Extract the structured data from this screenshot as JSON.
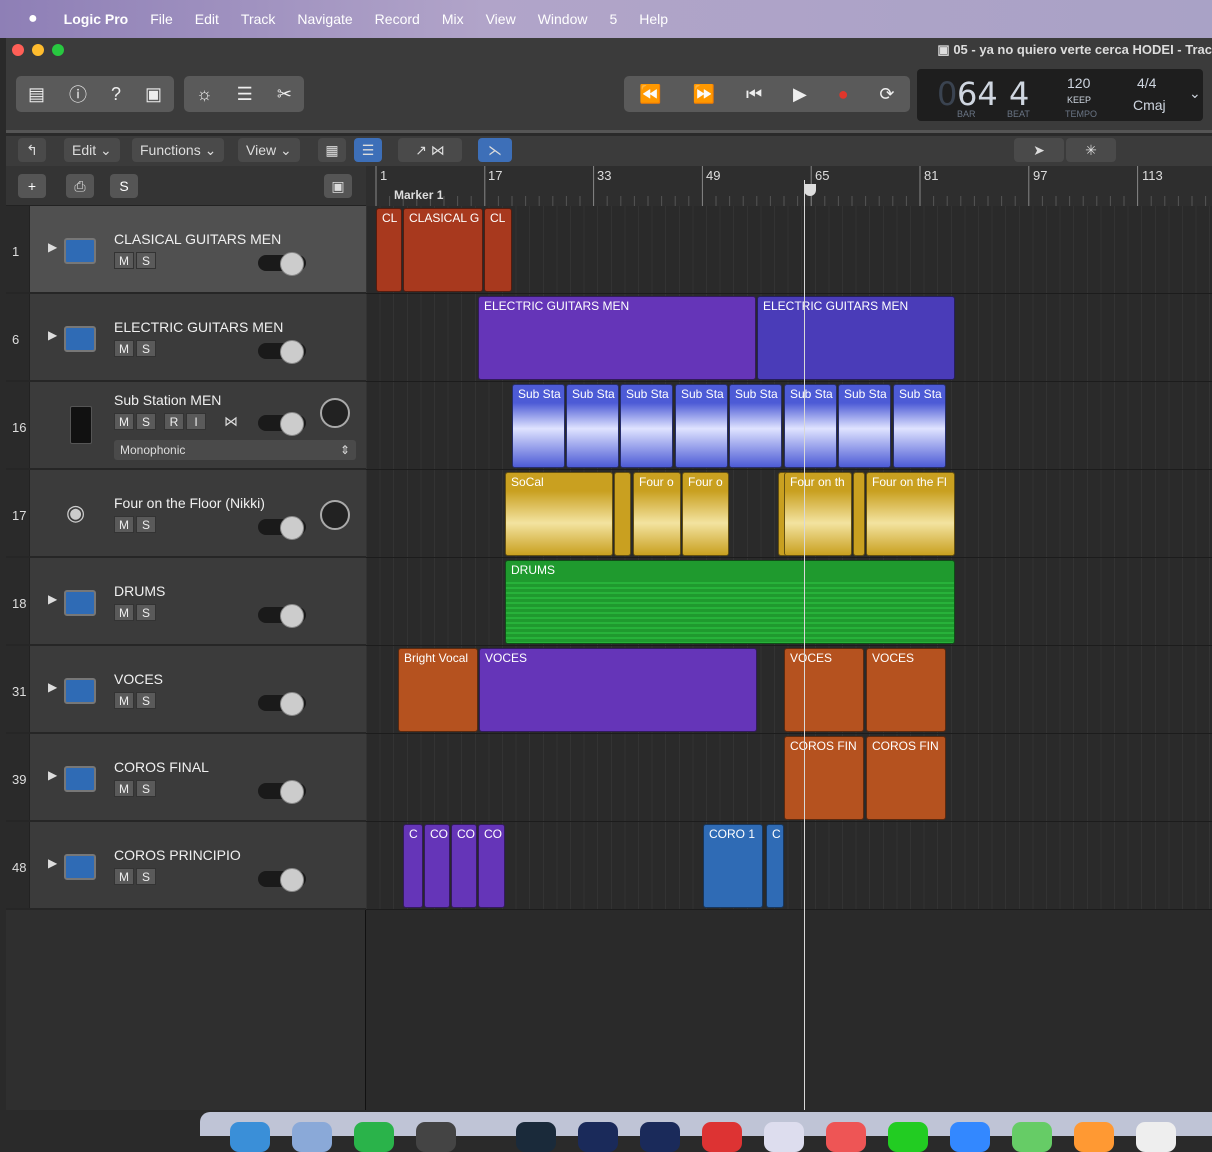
{
  "menubar": {
    "apple": "",
    "app": "Logic Pro",
    "items": [
      "File",
      "Edit",
      "Track",
      "Navigate",
      "Record",
      "Mix",
      "View",
      "Window",
      "5",
      "Help"
    ]
  },
  "window": {
    "title": "05 - ya no quiero verte cerca HODEI - Trac"
  },
  "lcd": {
    "bar": "64",
    "beat": "4",
    "bar_label": "BAR",
    "beat_label": "BEAT",
    "tempo": "120",
    "tempo_mode": "KEEP",
    "tempo_label": "TEMPO",
    "signature": "4/4",
    "key": "Cmaj",
    "bar_prefix": "0"
  },
  "controls": {
    "edit": "Edit",
    "functions": "Functions",
    "view": "View"
  },
  "track_header": {
    "add": "+",
    "solo": "S"
  },
  "ruler": {
    "bars": [
      "1",
      "17",
      "33",
      "49",
      "65",
      "81",
      "97",
      "113"
    ],
    "marker": "Marker 1"
  },
  "tracks": [
    {
      "num": "1",
      "name": "CLASICAL GUITARS MEN",
      "m": "M",
      "s": "S"
    },
    {
      "num": "6",
      "name": "ELECTRIC GUITARS MEN",
      "m": "M",
      "s": "S"
    },
    {
      "num": "16",
      "name": "Sub Station MEN",
      "m": "M",
      "s": "S",
      "r": "R",
      "i": "I",
      "mode": "Monophonic"
    },
    {
      "num": "17",
      "name": "Four on the Floor (Nikki)",
      "m": "M",
      "s": "S"
    },
    {
      "num": "18",
      "name": "DRUMS",
      "m": "M",
      "s": "S"
    },
    {
      "num": "31",
      "name": "VOCES",
      "m": "M",
      "s": "S"
    },
    {
      "num": "39",
      "name": "COROS FINAL",
      "m": "M",
      "s": "S"
    },
    {
      "num": "48",
      "name": "COROS PRINCIPIO",
      "m": "M",
      "s": "S"
    }
  ],
  "regions": {
    "r0a": "CL",
    "r0b": "CLASICAL G",
    "r0c": "CL",
    "r1a": "ELECTRIC GUITARS MEN",
    "r1b": "ELECTRIC GUITARS MEN",
    "r2": [
      "Sub Sta",
      "Sub Sta",
      "Sub Sta",
      "Sub Sta",
      "Sub Sta",
      "Sub Sta",
      "Sub Sta",
      "Sub Sta"
    ],
    "r3a": "SoCal",
    "r3b": "Four o",
    "r3c": "Four o",
    "r3d": "Four on th",
    "r3e": "Four on the Fl",
    "r4": "DRUMS",
    "r5a": "Bright Vocal",
    "r5b": "VOCES",
    "r5c": "VOCES",
    "r5d": "VOCES",
    "r6a": "COROS FIN",
    "r6b": "COROS FIN",
    "r7a": "C",
    "r7b": "CO",
    "r7c": "CO",
    "r7d": "CO",
    "r7e": "CORO 1",
    "r7f": "C"
  },
  "colors": {
    "red": "#a8391e",
    "purple": "#6535b8",
    "indigo": "#4a3cb8",
    "sub": "#4d5bd6",
    "yellow": "#c9a020",
    "green": "#1f9a2e",
    "orange": "#b5521f",
    "blue": "#2f6bb5",
    "rec": "#e0362b"
  }
}
